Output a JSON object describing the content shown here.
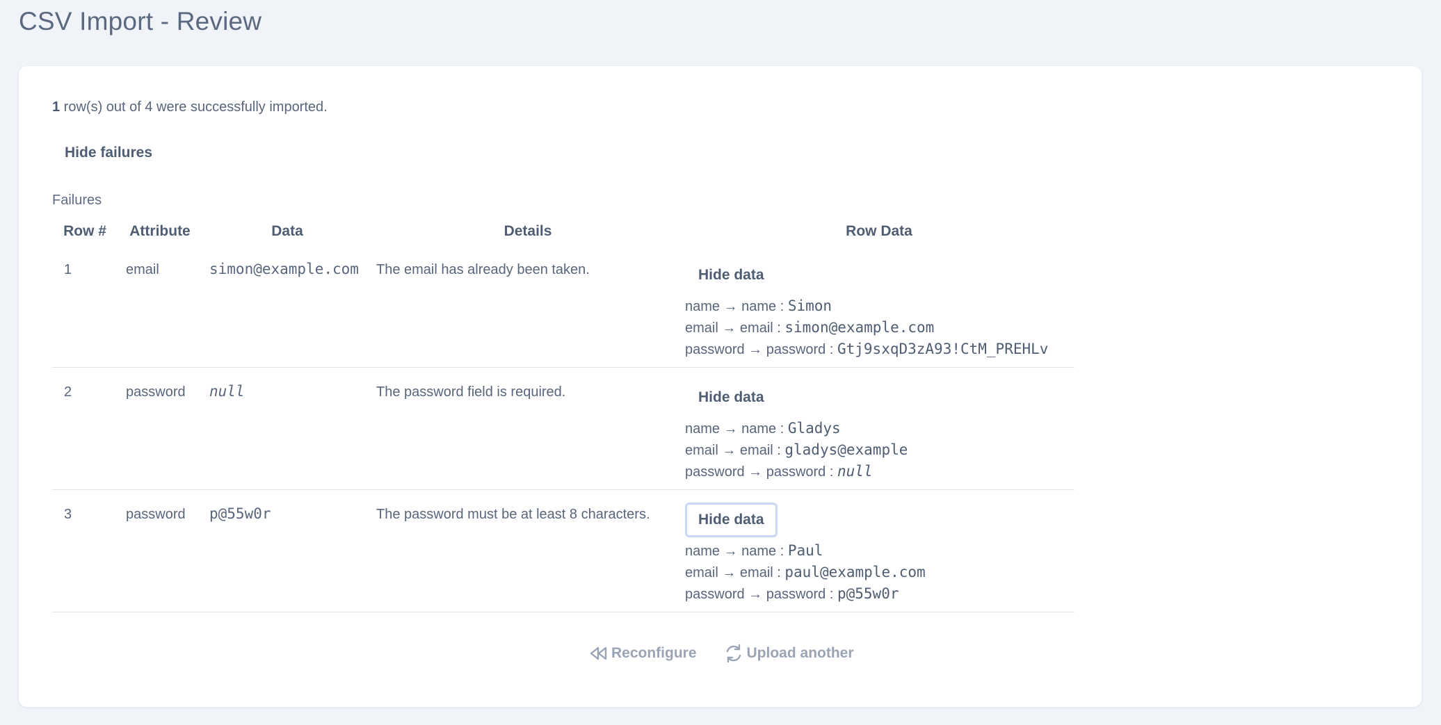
{
  "page": {
    "title": "CSV Import - Review"
  },
  "summary": {
    "imported": "1",
    "text": " row(s) out of 4 were successfully imported."
  },
  "toggle_failures_label": "Hide failures",
  "failures_caption": "Failures",
  "table": {
    "headers": [
      "Row #",
      "Attribute",
      "Data",
      "Details",
      "Row Data"
    ],
    "rows": [
      {
        "row": "1",
        "attribute": "email",
        "data": "simon@example.com",
        "details": "The email has already been taken.",
        "hide_label": "Hide data",
        "row_data": [
          {
            "label": "name → name : ",
            "value": "Simon"
          },
          {
            "label": "email → email : ",
            "value": "simon@example.com"
          },
          {
            "label": "password → password : ",
            "value": "Gtj9sxqD3zA93!CtM_PREHLv"
          }
        ]
      },
      {
        "row": "2",
        "attribute": "password",
        "data": "null",
        "details": "The password field is required.",
        "hide_label": "Hide data",
        "row_data": [
          {
            "label": "name → name : ",
            "value": "Gladys"
          },
          {
            "label": "email → email : ",
            "value": "gladys@example"
          },
          {
            "label": "password → password : ",
            "value": "null"
          }
        ]
      },
      {
        "row": "3",
        "attribute": "password",
        "data": "p@55w0r",
        "details": "The password must be at least 8 characters.",
        "hide_label": "Hide data",
        "row_data": [
          {
            "label": "name → name : ",
            "value": "Paul"
          },
          {
            "label": "email → email : ",
            "value": "paul@example.com"
          },
          {
            "label": "password → password : ",
            "value": "p@55w0r"
          }
        ]
      }
    ]
  },
  "actions": {
    "reconfigure": "Reconfigure",
    "upload_another": "Upload another"
  },
  "icons": {
    "reconfigure": "rewind-icon",
    "upload_another": "refresh-icon"
  },
  "colors": {
    "background": "#f0f4f9",
    "card": "#ffffff",
    "text": "#58657b",
    "muted_action": "#9aa4b4",
    "focus_ring": "#c9d9f6"
  }
}
